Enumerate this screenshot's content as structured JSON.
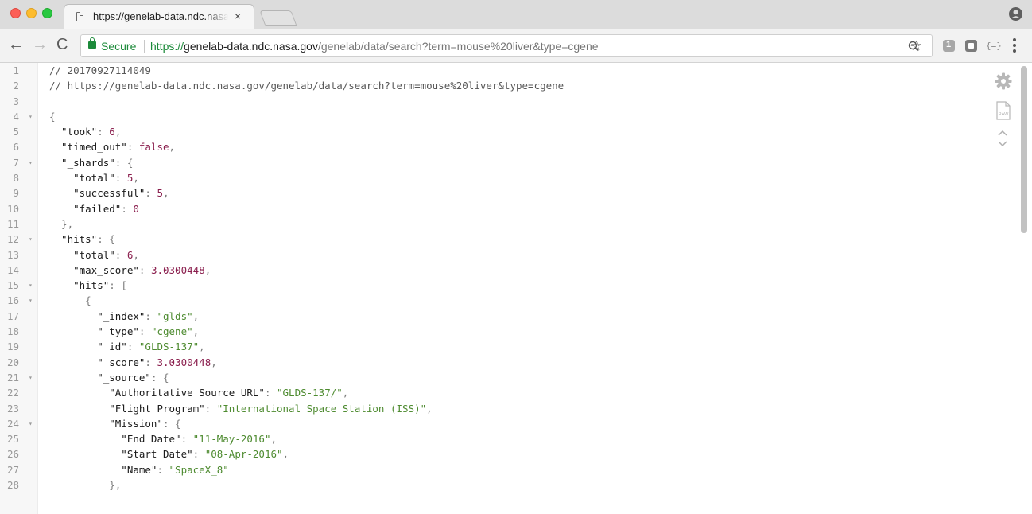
{
  "window": {
    "tab": {
      "title": "https://genelab-data.ndc.nasa",
      "close": "×"
    }
  },
  "toolbar": {
    "back": "←",
    "forward": "→",
    "reload": "C",
    "secure_label": "Secure",
    "url_scheme": "https://",
    "url_host": "genelab-data.ndc.nasa.gov",
    "url_path": "/genelab/data/search?term=mouse%20liver&type=cgene",
    "star": "☆",
    "ext3_label": "{=}"
  },
  "json_lines": [
    {
      "n": "1",
      "fold": "",
      "parts": [
        [
          "c",
          "// 20170927114049"
        ]
      ]
    },
    {
      "n": "2",
      "fold": "",
      "parts": [
        [
          "c",
          "// https://genelab-data.ndc.nasa.gov/genelab/data/search?term=mouse%20liver&type=cgene"
        ]
      ]
    },
    {
      "n": "3",
      "fold": "",
      "parts": []
    },
    {
      "n": "4",
      "fold": "▾",
      "parts": [
        [
          "p",
          "{"
        ]
      ]
    },
    {
      "n": "5",
      "fold": "",
      "parts": [
        [
          "k",
          "  \"took\""
        ],
        [
          "p",
          ": "
        ],
        [
          "n",
          "6"
        ],
        [
          "p",
          ","
        ]
      ]
    },
    {
      "n": "6",
      "fold": "",
      "parts": [
        [
          "k",
          "  \"timed_out\""
        ],
        [
          "p",
          ": "
        ],
        [
          "n",
          "false"
        ],
        [
          "p",
          ","
        ]
      ]
    },
    {
      "n": "7",
      "fold": "▾",
      "parts": [
        [
          "k",
          "  \"_shards\""
        ],
        [
          "p",
          ": {"
        ]
      ]
    },
    {
      "n": "8",
      "fold": "",
      "parts": [
        [
          "k",
          "    \"total\""
        ],
        [
          "p",
          ": "
        ],
        [
          "n",
          "5"
        ],
        [
          "p",
          ","
        ]
      ]
    },
    {
      "n": "9",
      "fold": "",
      "parts": [
        [
          "k",
          "    \"successful\""
        ],
        [
          "p",
          ": "
        ],
        [
          "n",
          "5"
        ],
        [
          "p",
          ","
        ]
      ]
    },
    {
      "n": "10",
      "fold": "",
      "parts": [
        [
          "k",
          "    \"failed\""
        ],
        [
          "p",
          ": "
        ],
        [
          "n",
          "0"
        ]
      ]
    },
    {
      "n": "11",
      "fold": "",
      "parts": [
        [
          "p",
          "  },"
        ]
      ]
    },
    {
      "n": "12",
      "fold": "▾",
      "parts": [
        [
          "k",
          "  \"hits\""
        ],
        [
          "p",
          ": {"
        ]
      ]
    },
    {
      "n": "13",
      "fold": "",
      "parts": [
        [
          "k",
          "    \"total\""
        ],
        [
          "p",
          ": "
        ],
        [
          "n",
          "6"
        ],
        [
          "p",
          ","
        ]
      ]
    },
    {
      "n": "14",
      "fold": "",
      "parts": [
        [
          "k",
          "    \"max_score\""
        ],
        [
          "p",
          ": "
        ],
        [
          "n",
          "3.0300448"
        ],
        [
          "p",
          ","
        ]
      ]
    },
    {
      "n": "15",
      "fold": "▾",
      "parts": [
        [
          "k",
          "    \"hits\""
        ],
        [
          "p",
          ": ["
        ]
      ]
    },
    {
      "n": "16",
      "fold": "▾",
      "parts": [
        [
          "p",
          "      {"
        ]
      ]
    },
    {
      "n": "17",
      "fold": "",
      "parts": [
        [
          "k",
          "        \"_index\""
        ],
        [
          "p",
          ": "
        ],
        [
          "s",
          "\"glds\""
        ],
        [
          "p",
          ","
        ]
      ]
    },
    {
      "n": "18",
      "fold": "",
      "parts": [
        [
          "k",
          "        \"_type\""
        ],
        [
          "p",
          ": "
        ],
        [
          "s",
          "\"cgene\""
        ],
        [
          "p",
          ","
        ]
      ]
    },
    {
      "n": "19",
      "fold": "",
      "parts": [
        [
          "k",
          "        \"_id\""
        ],
        [
          "p",
          ": "
        ],
        [
          "s",
          "\"GLDS-137\""
        ],
        [
          "p",
          ","
        ]
      ]
    },
    {
      "n": "20",
      "fold": "",
      "parts": [
        [
          "k",
          "        \"_score\""
        ],
        [
          "p",
          ": "
        ],
        [
          "n",
          "3.0300448"
        ],
        [
          "p",
          ","
        ]
      ]
    },
    {
      "n": "21",
      "fold": "▾",
      "parts": [
        [
          "k",
          "        \"_source\""
        ],
        [
          "p",
          ": {"
        ]
      ]
    },
    {
      "n": "22",
      "fold": "",
      "parts": [
        [
          "k",
          "          \"Authoritative Source URL\""
        ],
        [
          "p",
          ": "
        ],
        [
          "s",
          "\"GLDS-137/\""
        ],
        [
          "p",
          ","
        ]
      ]
    },
    {
      "n": "23",
      "fold": "",
      "parts": [
        [
          "k",
          "          \"Flight Program\""
        ],
        [
          "p",
          ": "
        ],
        [
          "s",
          "\"International Space Station (ISS)\""
        ],
        [
          "p",
          ","
        ]
      ]
    },
    {
      "n": "24",
      "fold": "▾",
      "parts": [
        [
          "k",
          "          \"Mission\""
        ],
        [
          "p",
          ": {"
        ]
      ]
    },
    {
      "n": "25",
      "fold": "",
      "parts": [
        [
          "k",
          "            \"End Date\""
        ],
        [
          "p",
          ": "
        ],
        [
          "s",
          "\"11-May-2016\""
        ],
        [
          "p",
          ","
        ]
      ]
    },
    {
      "n": "26",
      "fold": "",
      "parts": [
        [
          "k",
          "            \"Start Date\""
        ],
        [
          "p",
          ": "
        ],
        [
          "s",
          "\"08-Apr-2016\""
        ],
        [
          "p",
          ","
        ]
      ]
    },
    {
      "n": "27",
      "fold": "",
      "parts": [
        [
          "k",
          "            \"Name\""
        ],
        [
          "p",
          ": "
        ],
        [
          "s",
          "\"SpaceX_8\""
        ]
      ]
    },
    {
      "n": "28",
      "fold": "",
      "parts": [
        [
          "p",
          "          },"
        ]
      ]
    }
  ],
  "tools": {
    "raw_label": "RAW"
  },
  "colors": {
    "secure_green": "#1c8a3a",
    "number": "#8a1e4d",
    "string": "#4e8b30"
  }
}
